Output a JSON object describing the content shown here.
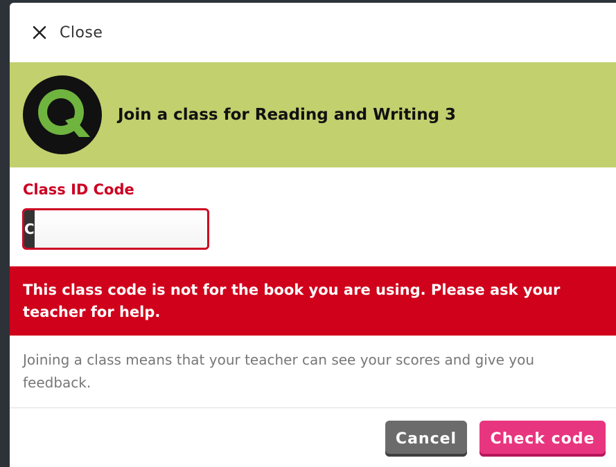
{
  "dialog": {
    "close_label": "Close",
    "header_title": "Join a class for Reading and Writing 3",
    "logo_icon": "q-logo-icon"
  },
  "form": {
    "field_label": "Class ID Code",
    "code_prefix": "C",
    "code_value": "",
    "code_placeholder": ""
  },
  "error": {
    "message": "This class code is not for the book you are using. Please ask your teacher for help."
  },
  "info": {
    "text": "Joining a class means that your teacher can see your scores and give you feedback."
  },
  "actions": {
    "cancel_label": "Cancel",
    "check_label": "Check code"
  },
  "colors": {
    "header_band": "#c2d06e",
    "error": "#d0021b",
    "primary_button": "#e8357f",
    "secondary_button": "#6b6b6b"
  }
}
